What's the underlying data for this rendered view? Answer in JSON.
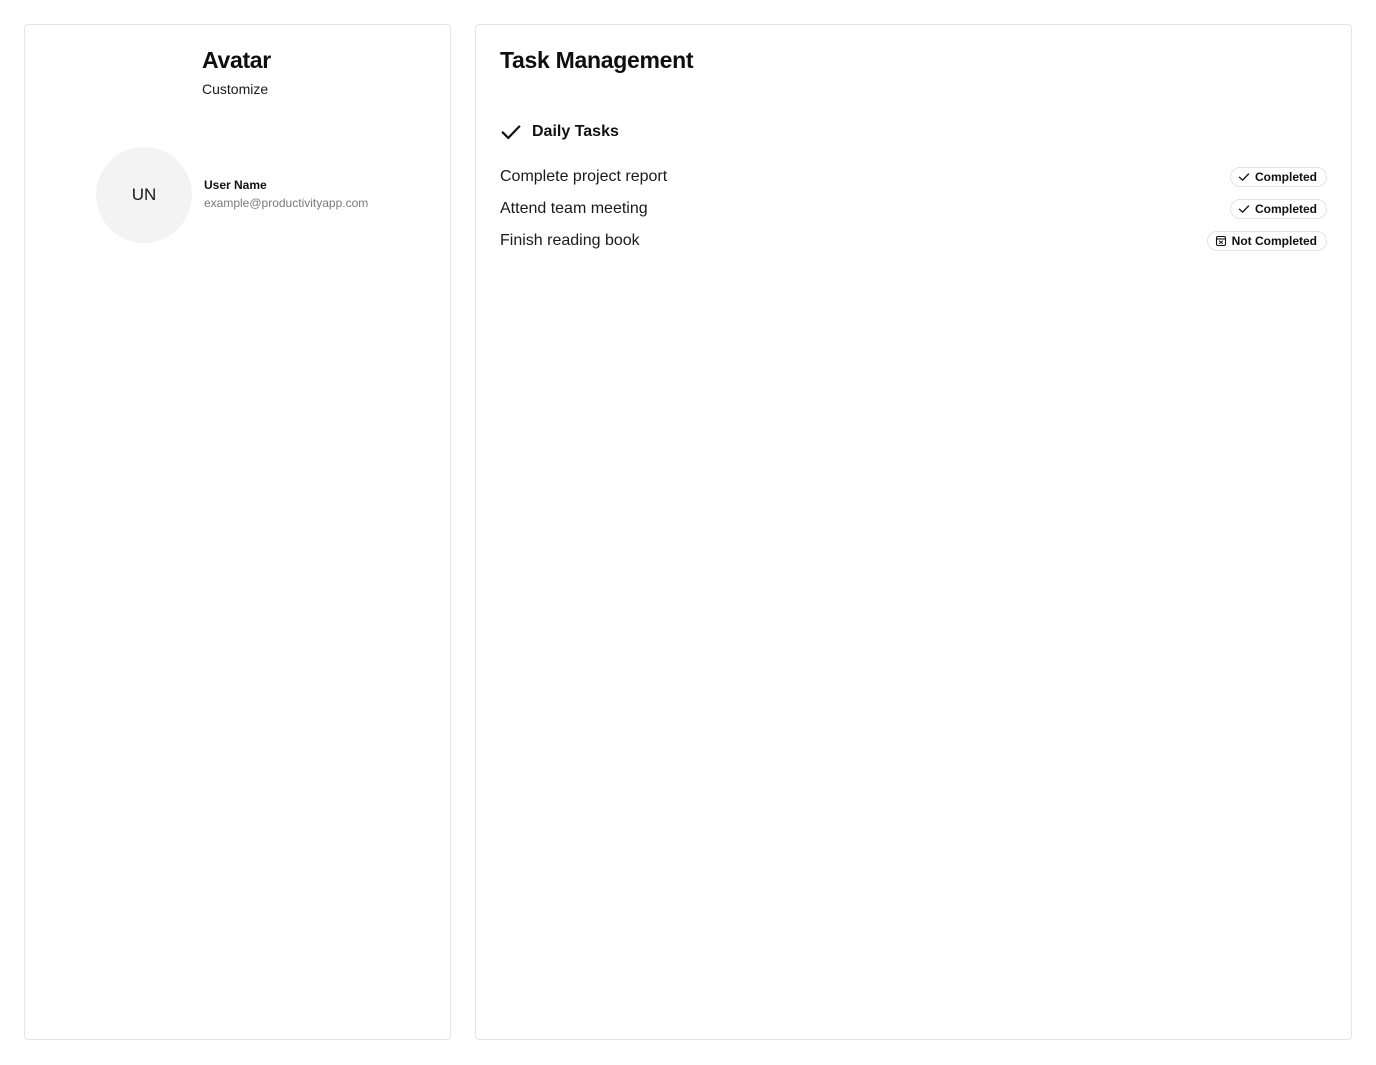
{
  "avatar_card": {
    "title": "Avatar",
    "subtitle": "Customize",
    "initials": "UN",
    "user_name": "User Name",
    "email": "example@productivityapp.com"
  },
  "task_card": {
    "title": "Task Management",
    "section": {
      "icon": "check-icon",
      "title": "Daily Tasks"
    },
    "tasks": [
      {
        "label": "Complete project report",
        "status": "Completed",
        "status_icon": "check-icon"
      },
      {
        "label": "Attend team meeting",
        "status": "Completed",
        "status_icon": "check-icon"
      },
      {
        "label": "Finish reading book",
        "status": "Not Completed",
        "status_icon": "calendar-x-icon"
      }
    ]
  },
  "colors": {
    "border": "#e5e5e5",
    "avatar_bg": "#f3f3f3",
    "muted_text": "#7a7a7a"
  }
}
